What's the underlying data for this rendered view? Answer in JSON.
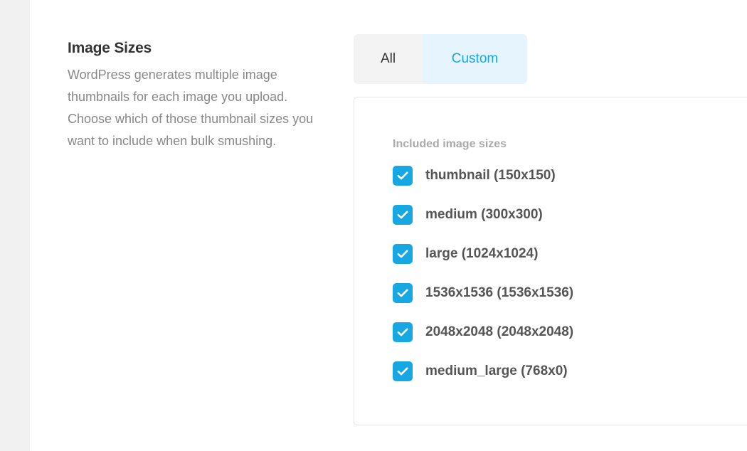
{
  "settings": {
    "title": "Image Sizes",
    "description": "WordPress generates multiple image thumbnails for each image you upload. Choose which of those thumbnail sizes you want to include when bulk smushing."
  },
  "tabs": {
    "all_label": "All",
    "custom_label": "Custom",
    "selected": "Custom"
  },
  "panel": {
    "included_label": "Included image sizes",
    "sizes": [
      {
        "label": "thumbnail (150x150)",
        "checked": true
      },
      {
        "label": "medium (300x300)",
        "checked": true
      },
      {
        "label": "large (1024x1024)",
        "checked": true
      },
      {
        "label": "1536x1536 (1536x1536)",
        "checked": true
      },
      {
        "label": "2048x2048 (2048x2048)",
        "checked": true
      },
      {
        "label": "medium_large (768x0)",
        "checked": true
      }
    ]
  },
  "colors": {
    "accent": "#17a8e3",
    "selected_tab_bg": "#e6f4fd"
  },
  "icons": {
    "checkbox": "checkmark-icon"
  }
}
